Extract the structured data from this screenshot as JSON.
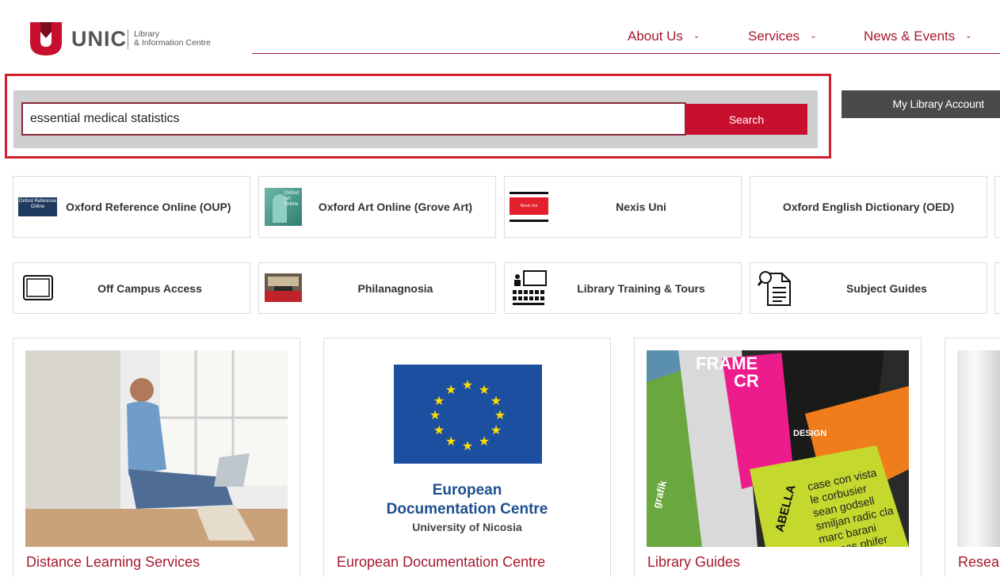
{
  "brand": {
    "name": "UNIC",
    "subtitle_line1": "Library",
    "subtitle_line2": "& Information Centre",
    "accent_color": "#a6192e"
  },
  "nav": {
    "items": [
      {
        "label": "About Us",
        "icon": "chevron-down-icon"
      },
      {
        "label": "Services",
        "icon": "chevron-down-icon"
      },
      {
        "label": "News & Events",
        "icon": "chevron-down-icon"
      }
    ]
  },
  "search": {
    "value": "essential medical statistics",
    "button_label": "Search"
  },
  "account": {
    "label": "My Library Account"
  },
  "quick_links": {
    "row1": [
      {
        "label": "Oxford Reference Online (OUP)",
        "icon_text": "Oxford Reference Online"
      },
      {
        "label": "Oxford Art Online (Grove Art)",
        "icon_text": "Oxford Art Online"
      },
      {
        "label": "Nexis Uni",
        "icon_text": "Nexis Uni"
      },
      {
        "label": "Oxford English Dictionary (OED)"
      }
    ],
    "row2": [
      {
        "label": "Off Campus Access",
        "icon": "tablet-icon"
      },
      {
        "label": "Philanagnosia",
        "icon": "library-hall-icon"
      },
      {
        "label": "Library Training & Tours",
        "icon": "classroom-icon"
      },
      {
        "label": "Subject Guides",
        "icon": "document-search-icon"
      }
    ]
  },
  "cards": [
    {
      "title": "Distance Learning Services"
    },
    {
      "title": "European Documentation Centre",
      "caption_line1": "European",
      "caption_line2": "Documentation Centre",
      "caption_line3": "University of Nicosia"
    },
    {
      "title": "Library Guides",
      "magazine_texts": [
        "FRAME",
        "CR",
        "case con vista",
        "le corbusier",
        "sean godsell",
        "smiljan radic cla",
        "marc barani",
        "thomas phifer",
        "grafik",
        "DESIGN",
        "ABELLA"
      ]
    },
    {
      "title": "Research"
    }
  ]
}
